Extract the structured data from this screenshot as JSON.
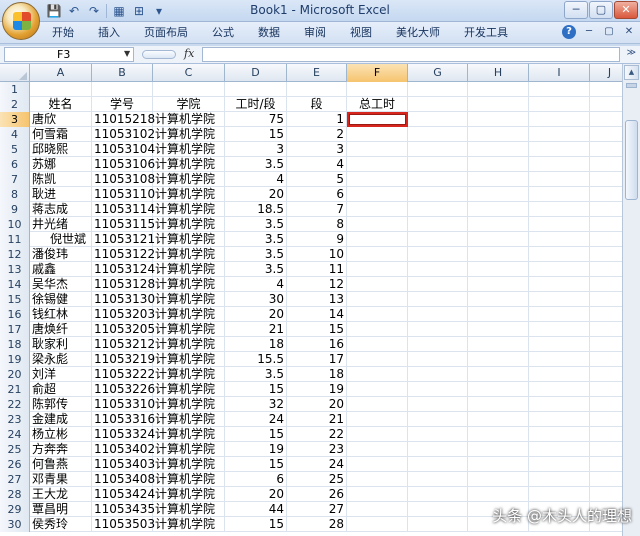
{
  "window": {
    "title": "Book1 - Microsoft Excel",
    "controls": [
      "─",
      "▢",
      "✕"
    ]
  },
  "quick_access": [
    "💾",
    "↶",
    "↷",
    "▦",
    "⊞",
    "▾"
  ],
  "ribbon": {
    "tabs": [
      "开始",
      "插入",
      "页面布局",
      "公式",
      "数据",
      "审阅",
      "视图",
      "美化大师",
      "开发工具"
    ],
    "help": "?",
    "right_controls": [
      "─",
      "▢",
      "✕"
    ]
  },
  "formula_bar": {
    "name_box": "F3",
    "fx": "fx",
    "formula": ""
  },
  "grid": {
    "columns": [
      "A",
      "B",
      "C",
      "D",
      "E",
      "F",
      "G",
      "H",
      "I",
      "J"
    ],
    "active_column": "F",
    "active_row": "3",
    "header_row": {
      "row": "2",
      "cells": [
        "姓名",
        "学号",
        "学院",
        "工时/段",
        "段",
        "总工时"
      ]
    },
    "rows": [
      {
        "row": "1",
        "cells": [
          "",
          "",
          "",
          "",
          "",
          ""
        ]
      },
      {
        "row": "3",
        "cells": [
          "唐欣",
          "11015218",
          "计算机学院",
          "75",
          "1",
          ""
        ]
      },
      {
        "row": "4",
        "cells": [
          "何雪霜",
          "11053102",
          "计算机学院",
          "15",
          "2",
          ""
        ]
      },
      {
        "row": "5",
        "cells": [
          "邱晓熙",
          "11053104",
          "计算机学院",
          "3",
          "3",
          ""
        ]
      },
      {
        "row": "6",
        "cells": [
          "苏娜",
          "11053106",
          "计算机学院",
          "3.5",
          "4",
          ""
        ]
      },
      {
        "row": "7",
        "cells": [
          "陈凯",
          "11053108",
          "计算机学院",
          "4",
          "5",
          ""
        ]
      },
      {
        "row": "8",
        "cells": [
          "耿进",
          "11053110",
          "计算机学院",
          "20",
          "6",
          ""
        ]
      },
      {
        "row": "9",
        "cells": [
          "蒋志成",
          "11053114",
          "计算机学院",
          "18.5",
          "7",
          ""
        ]
      },
      {
        "row": "10",
        "cells": [
          "井光绪",
          "11053115",
          "计算机学院",
          "3.5",
          "8",
          ""
        ]
      },
      {
        "row": "11",
        "cells": [
          "倪世斌",
          "11053121",
          "计算机学院",
          "3.5",
          "9",
          ""
        ]
      },
      {
        "row": "12",
        "cells": [
          "潘俊玮",
          "11053122",
          "计算机学院",
          "3.5",
          "10",
          ""
        ]
      },
      {
        "row": "13",
        "cells": [
          "戚鑫",
          "11053124",
          "计算机学院",
          "3.5",
          "11",
          ""
        ]
      },
      {
        "row": "14",
        "cells": [
          "吴华杰",
          "11053128",
          "计算机学院",
          "4",
          "12",
          ""
        ]
      },
      {
        "row": "15",
        "cells": [
          "徐锡健",
          "11053130",
          "计算机学院",
          "30",
          "13",
          ""
        ]
      },
      {
        "row": "16",
        "cells": [
          "钱红林",
          "11053203",
          "计算机学院",
          "20",
          "14",
          ""
        ]
      },
      {
        "row": "17",
        "cells": [
          "唐焕纤",
          "11053205",
          "计算机学院",
          "21",
          "15",
          ""
        ]
      },
      {
        "row": "18",
        "cells": [
          "耿家利",
          "11053212",
          "计算机学院",
          "18",
          "16",
          ""
        ]
      },
      {
        "row": "19",
        "cells": [
          "梁永彪",
          "11053219",
          "计算机学院",
          "15.5",
          "17",
          ""
        ]
      },
      {
        "row": "20",
        "cells": [
          "刘洋",
          "11053222",
          "计算机学院",
          "3.5",
          "18",
          ""
        ]
      },
      {
        "row": "21",
        "cells": [
          "俞超",
          "11053226",
          "计算机学院",
          "15",
          "19",
          ""
        ]
      },
      {
        "row": "22",
        "cells": [
          "陈郭传",
          "11053310",
          "计算机学院",
          "32",
          "20",
          ""
        ]
      },
      {
        "row": "23",
        "cells": [
          "金建成",
          "11053316",
          "计算机学院",
          "24",
          "21",
          ""
        ]
      },
      {
        "row": "24",
        "cells": [
          "杨立彬",
          "11053324",
          "计算机学院",
          "15",
          "22",
          ""
        ]
      },
      {
        "row": "25",
        "cells": [
          "方奔奔",
          "11053402",
          "计算机学院",
          "19",
          "23",
          ""
        ]
      },
      {
        "row": "26",
        "cells": [
          "何鲁燕",
          "11053403",
          "计算机学院",
          "15",
          "24",
          ""
        ]
      },
      {
        "row": "27",
        "cells": [
          "邓青果",
          "11053408",
          "计算机学院",
          "6",
          "25",
          ""
        ]
      },
      {
        "row": "28",
        "cells": [
          "王大龙",
          "11053424",
          "计算机学院",
          "20",
          "26",
          ""
        ]
      },
      {
        "row": "29",
        "cells": [
          "覃昌明",
          "11053435",
          "计算机学院",
          "44",
          "27",
          ""
        ]
      },
      {
        "row": "30",
        "cells": [
          "侯秀玲",
          "11053503",
          "计算机学院",
          "15",
          "28",
          ""
        ]
      }
    ]
  },
  "scrollbar": {
    "up": "▲"
  },
  "watermark": "头条 @木头人的理想",
  "colors": {
    "selection_border": "#d7261e",
    "active_header": "#f6c46e",
    "ribbon_bg": "#d3e1f3"
  }
}
